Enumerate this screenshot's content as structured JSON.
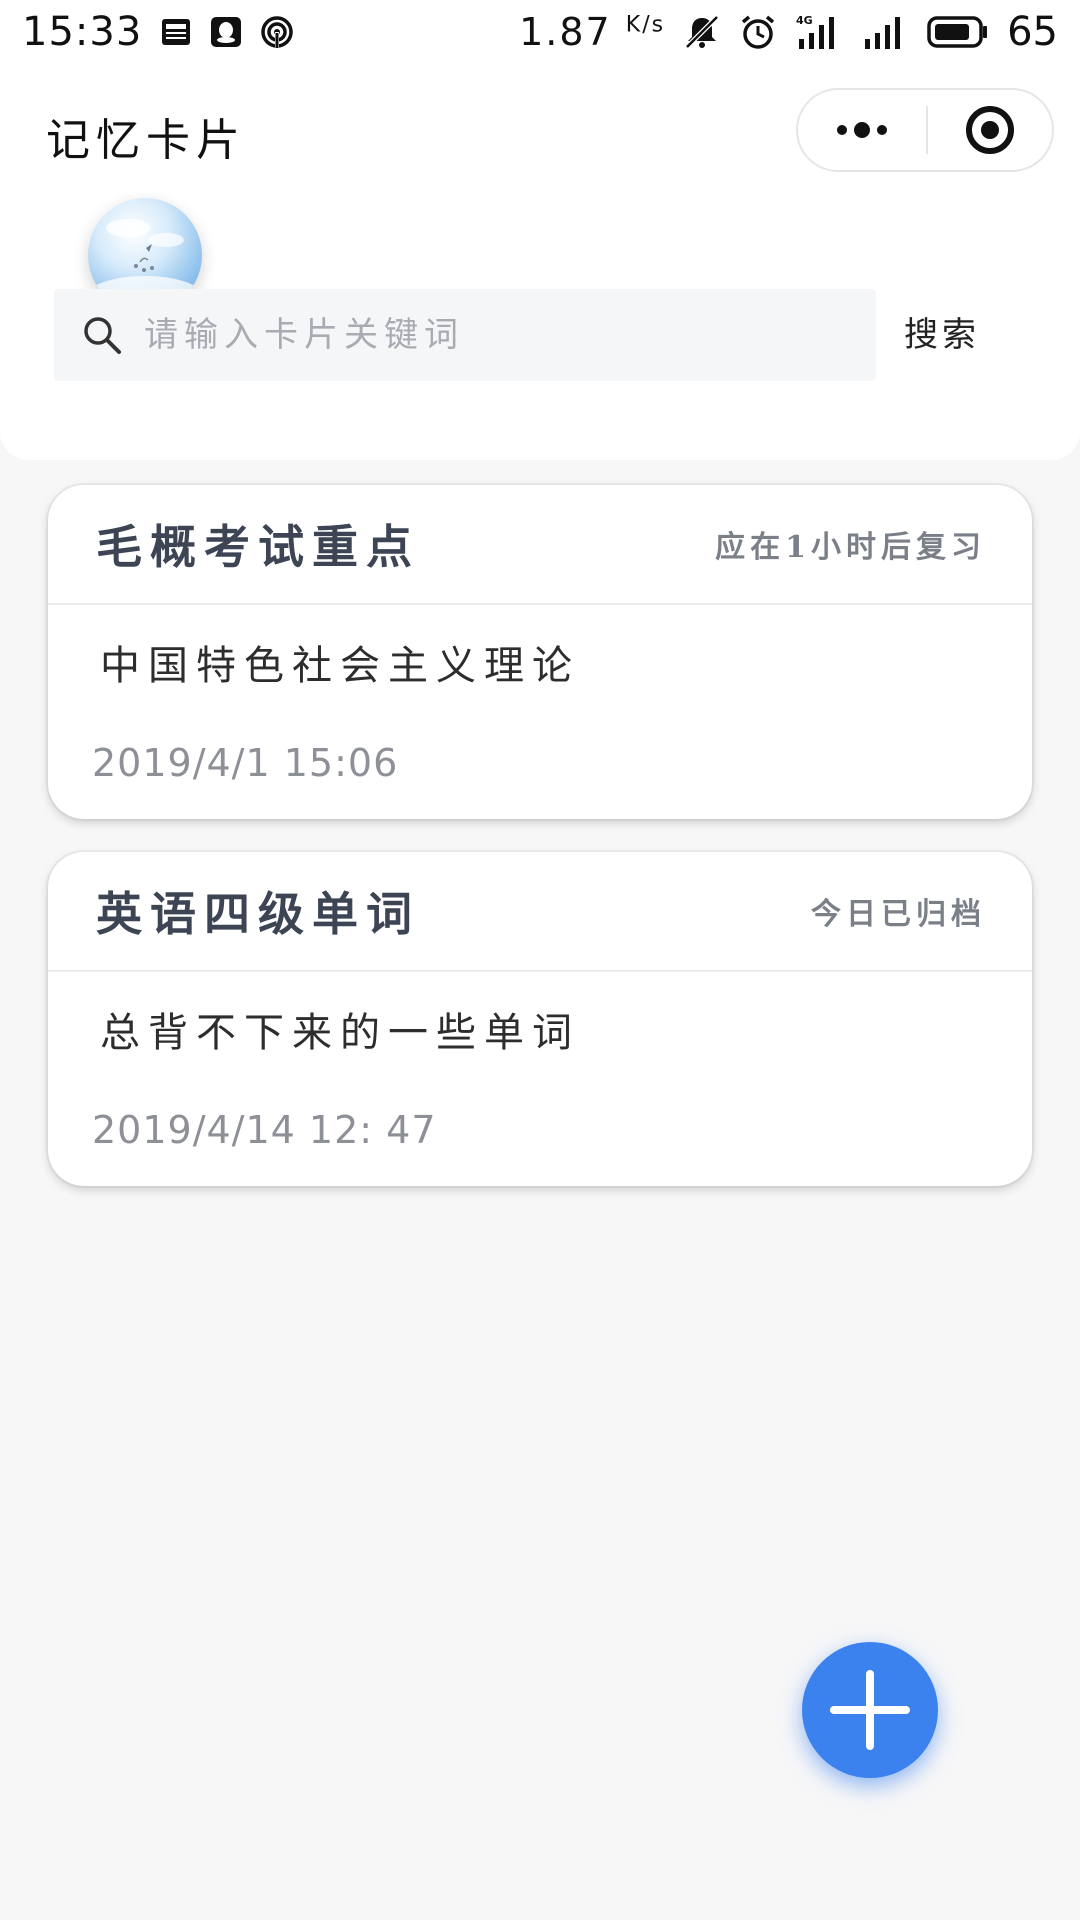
{
  "status_bar": {
    "time": "15:33",
    "speed": "1.87",
    "speed_unit": "K/s",
    "battery": "65",
    "network": "4G"
  },
  "header": {
    "title": "记忆卡片"
  },
  "search": {
    "placeholder": "请输入卡片关键词",
    "button_label": "搜索"
  },
  "cards": [
    {
      "title": "毛概考试重点",
      "status": "应在1小时后复习",
      "description": "中国特色社会主义理论",
      "date": "2019/4/1 15:06"
    },
    {
      "title": "英语四级单词",
      "status": "今日已归档",
      "description": "总背不下来的一些单词",
      "date": "2019/4/14 12: 47"
    }
  ],
  "colors": {
    "accent": "#3b82ef",
    "card_title": "#3d4454",
    "muted": "#8d9096",
    "background": "#f7f7f8"
  },
  "icons": {
    "fab": "plus-icon",
    "search": "search-icon",
    "capsule_more": "more-icon",
    "capsule_close": "close-target-icon"
  }
}
